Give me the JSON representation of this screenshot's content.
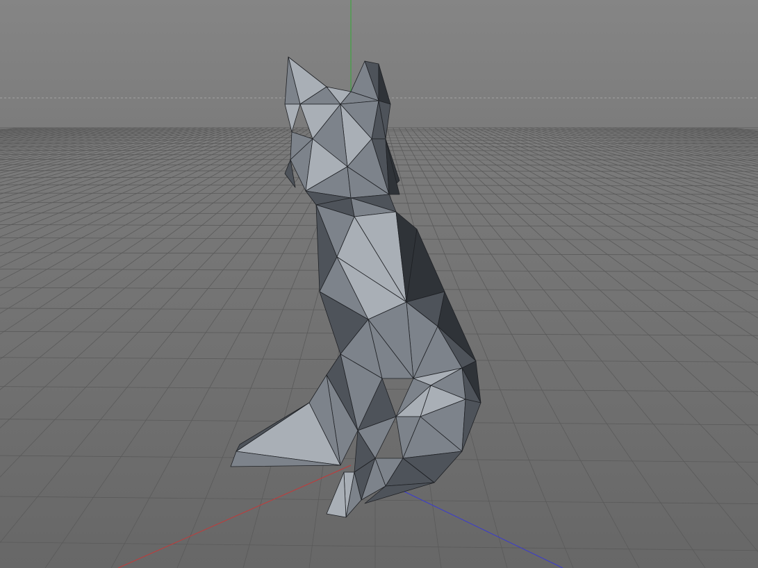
{
  "viewport": {
    "view": "perspective",
    "grid": true,
    "colors": {
      "background_top": "#858585",
      "background_bottom": "#6a6a6a",
      "grid_line": "#5a5a5a",
      "horizon_line": "#b0b0b0",
      "axis_x": "#c23a3a",
      "axis_y": "#33aa33",
      "axis_z": "#3a3ad0",
      "model_light": "#a9afb6",
      "model_mid": "#7d838b",
      "model_dark": "#4e535a",
      "model_shadow": "#2f3338",
      "model_edge": "#1e2024"
    },
    "scene_object": {
      "icon": "low-poly-cat-model-icon",
      "shading": "flat",
      "wireframe_edges": true
    }
  }
}
